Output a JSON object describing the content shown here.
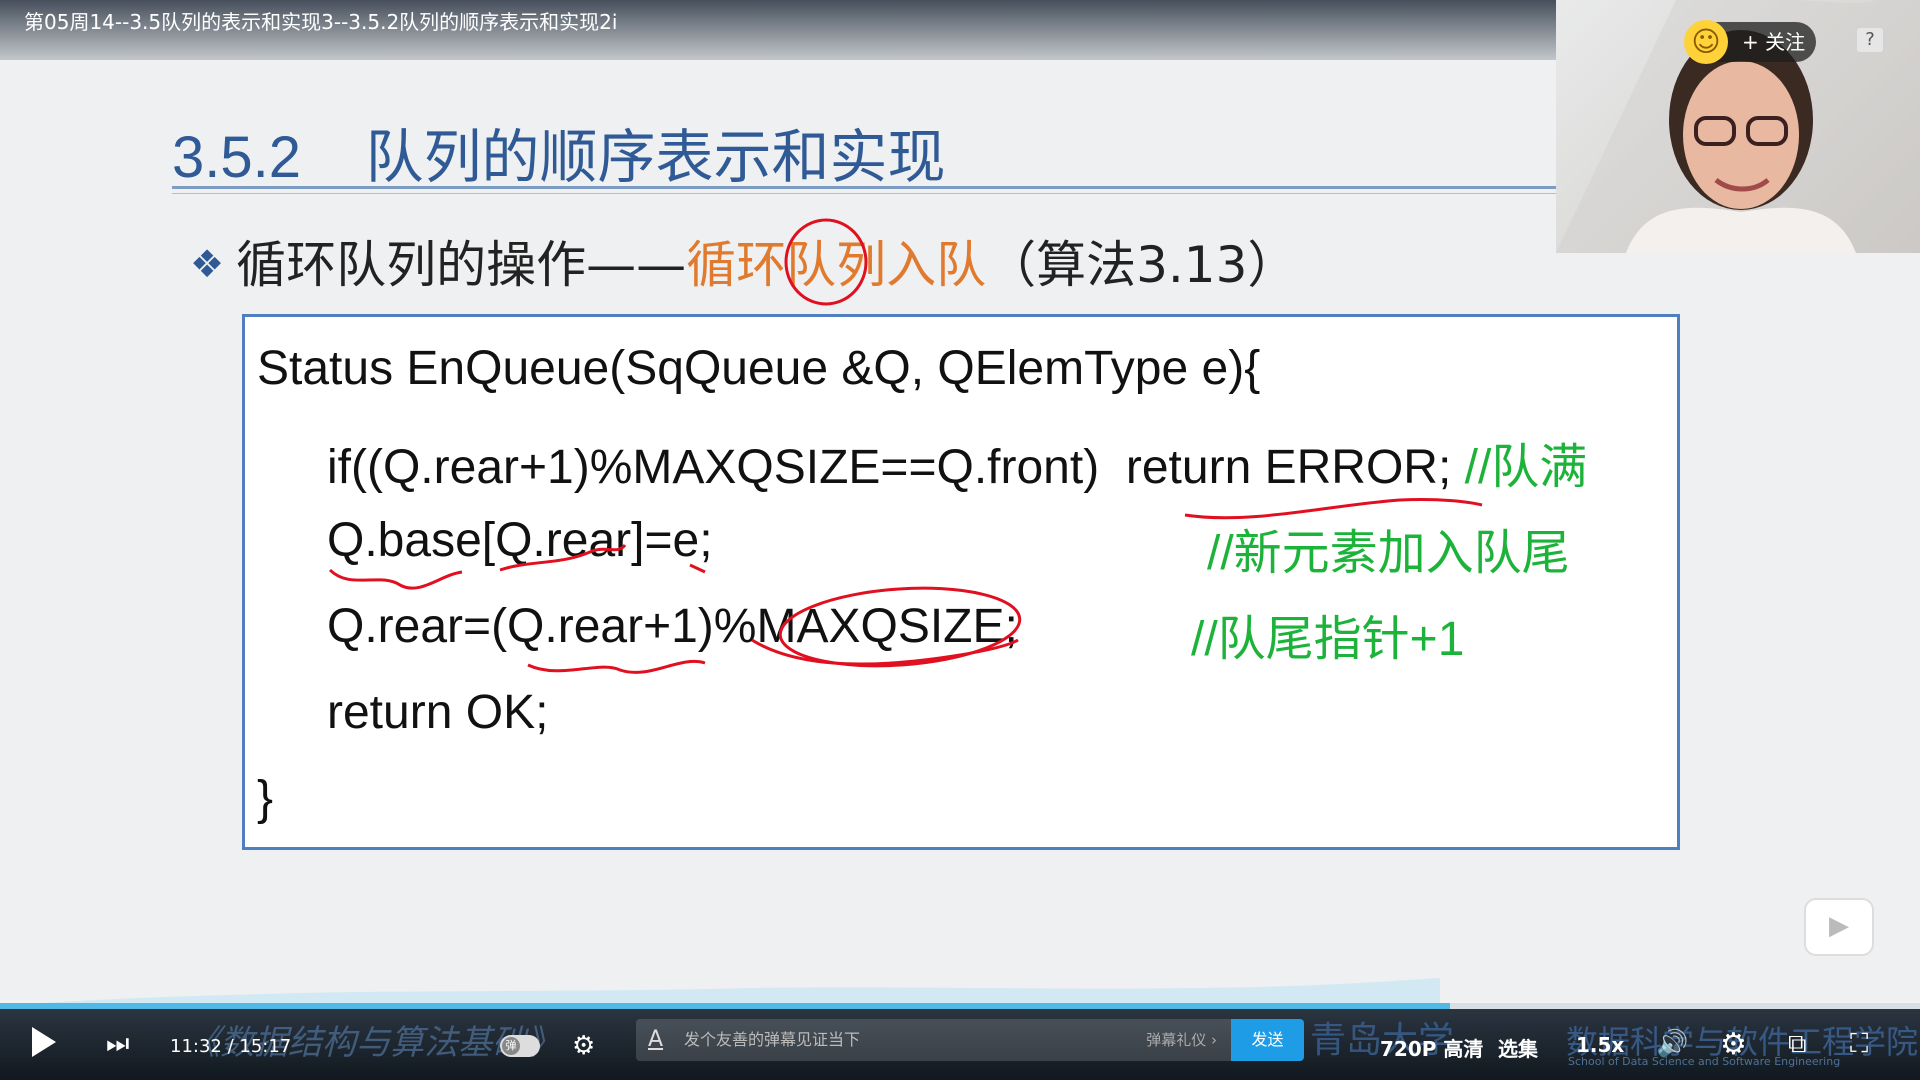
{
  "window": {
    "title": "第05周14--3.5队列的表示和实现3--3.5.2队列的顺序表示和实现2i"
  },
  "slide": {
    "section_number": "3.5.2",
    "title": "队列的顺序表示和实现",
    "bullet_icon": "diamond-bullet-icon",
    "subtitle_prefix": "循环队列的操作——",
    "subtitle_highlight": "循环队列入队",
    "subtitle_suffix": "（算法3.13）",
    "code": {
      "line1": "Status EnQueue(SqQueue &Q, QElemType e){",
      "line2_code": "if((Q.rear+1)%MAXQSIZE==Q.front)  return ERROR;",
      "line2_comment": "//队满",
      "line3_code": "Q.base[Q.rear]=e;",
      "line3_comment": "//新元素加入队尾",
      "line4_code": "Q.rear=(Q.rear+1)%MAXQSIZE;",
      "line4_comment": "//队尾指针+1",
      "line5_code": "return OK;",
      "line6": "}"
    },
    "colors": {
      "title": "#2f5a96",
      "highlight": "#e07a2e",
      "comment": "#1db33a",
      "annotation": "#e01020",
      "box_border": "#4f7fc0"
    }
  },
  "overlay": {
    "follow_label": "+ 关注",
    "smile_icon": "smile-face-icon",
    "help_label": "?"
  },
  "player": {
    "current_time": "11:32",
    "total_time": "15:17",
    "progress": 0.755,
    "course_watermark": "《数据结构与算法基础》",
    "danmu_toggle_label": "弹",
    "danmu_placeholder": "发个友善的弹幕见证当下",
    "danmu_gift_label": "弹幕礼仪 ›",
    "send_label": "发送",
    "university_watermark": "青岛大学",
    "quality_label": "720P 高清",
    "episodes_label": "选集",
    "department_watermark": "数据科学与软件工程学院",
    "department_en": "School of Data Science and Software Engineering",
    "speed_label": "1.5x",
    "danmu_input_icon_label": "A"
  }
}
